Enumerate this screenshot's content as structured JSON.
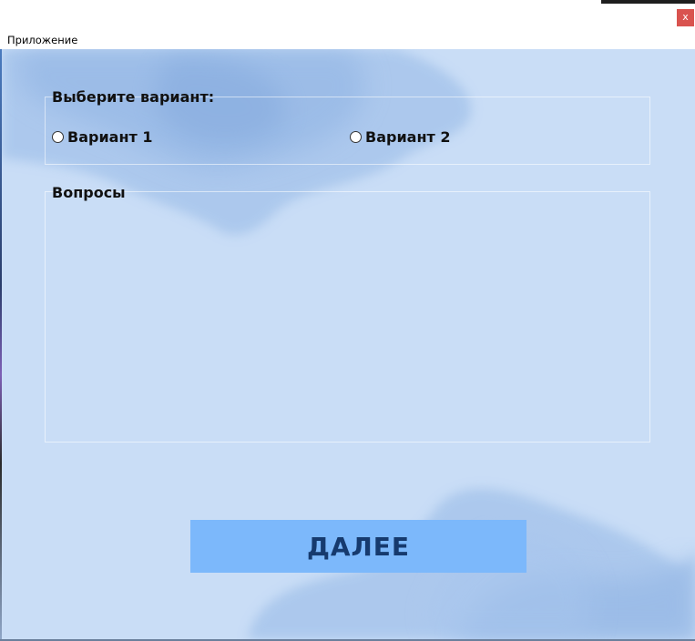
{
  "window": {
    "title": "Приложение",
    "close_label": "x"
  },
  "variant_group": {
    "legend": "Выберите вариант:",
    "options": [
      {
        "label": "Вариант 1",
        "selected": false
      },
      {
        "label": "Вариант 2",
        "selected": false
      }
    ]
  },
  "questions_group": {
    "legend": "Вопросы"
  },
  "next_button": {
    "label": "ДАЛЕЕ"
  },
  "colors": {
    "background": "#c9ddf6",
    "button": "#7cb8fb",
    "button_text": "#163a6e",
    "close_button": "#d9534f"
  }
}
